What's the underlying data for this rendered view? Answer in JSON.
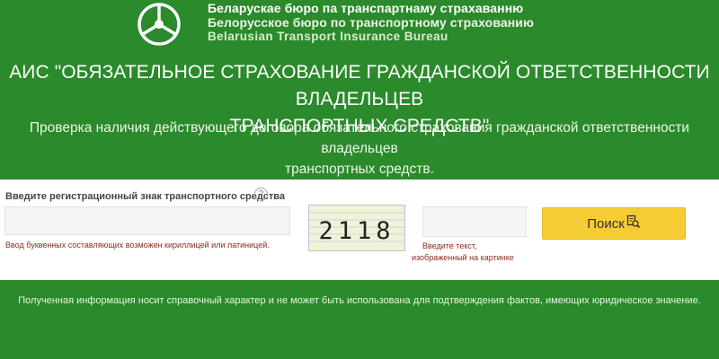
{
  "header": {
    "logo_icon": "steering-wheel-icon",
    "org_name_be": "Беларускае бюро па транспартнаму страхаванню",
    "org_name_ru": "Белорусское бюро по транспортному страхованию",
    "org_name_en": "Belarusian Transport Insurance Bureau"
  },
  "main": {
    "title_line1": "АИС \"ОБЯЗАТЕЛЬНОЕ СТРАХОВАНИЕ ГРАЖДАНСКОЙ ОТВЕТСТВЕННОСТИ ВЛАДЕЛЬЦЕВ",
    "title_line2": "ТРАНСПОРТНЫХ СРЕДСТВ\"",
    "subtitle_line1": "Проверка наличия действующего договора обязательного страхования гражданской ответственности владельцев",
    "subtitle_line2": "транспортных средств."
  },
  "form": {
    "reg_label": "Введите регистрационный знак транспортного средства",
    "help_icon": "?",
    "reg_value": "",
    "reg_hint": "Ввод буквенных составляющих возможен кириллицей или латиницей.",
    "captcha_text": "2118",
    "captcha_value": "",
    "captcha_hint_line1": "Введите текст,",
    "captcha_hint_line2": "изображенный на картинке",
    "search_label": "Поиск",
    "search_icon": "document-search-icon"
  },
  "footer": {
    "note": "Полученная информация носит справочный характер и не может быть использована для подтверждения фактов, имеющих юридическое значение."
  },
  "colors": {
    "background": "#2b8a2b",
    "search_button": "#f6cc35",
    "hint_text": "#8b2a1a"
  }
}
